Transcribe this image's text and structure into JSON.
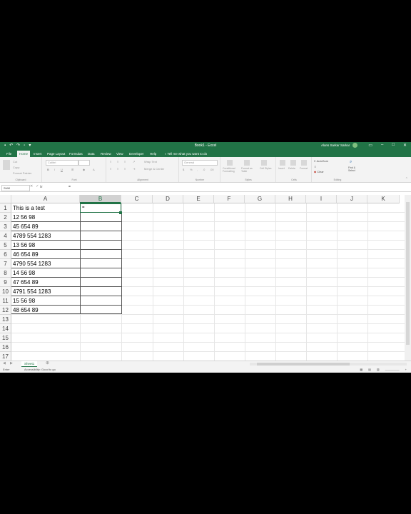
{
  "window": {
    "title": "Book1 - Excel",
    "user": "Alans Sarkar Sarkar"
  },
  "tabs": [
    {
      "label": "File"
    },
    {
      "label": "Home"
    },
    {
      "label": "Insert"
    },
    {
      "label": "Page Layout"
    },
    {
      "label": "Formulas"
    },
    {
      "label": "Data"
    },
    {
      "label": "Review"
    },
    {
      "label": "View"
    },
    {
      "label": "Developer"
    },
    {
      "label": "Help"
    }
  ],
  "tell_me": "Tell me what you want to do",
  "ribbon": {
    "clipboard": {
      "cut": "Cut",
      "copy": "Copy",
      "format_painter": "Format Painter",
      "label": "Clipboard"
    },
    "font": {
      "name": "Calibri",
      "label": "Font"
    },
    "alignment": {
      "wrap": "Wrap Text",
      "merge": "Merge & Center",
      "label": "Alignment"
    },
    "number": {
      "format": "General",
      "label": "Number"
    },
    "styles": {
      "conditional": "Conditional Formatting",
      "table": "Format as Table",
      "cell": "Cell Styles",
      "label": "Styles"
    },
    "cells": {
      "insert": "Insert",
      "delete": "Delete",
      "format": "Format",
      "label": "Cells"
    },
    "editing": {
      "autosum": "AutoSum",
      "clear": "Clear",
      "find": "Find & Select",
      "label": "Editing"
    }
  },
  "formula_bar": {
    "name_box": "SUM",
    "fx": "fx",
    "content": "="
  },
  "columns": [
    "A",
    "B",
    "C",
    "D",
    "E",
    "F",
    "G",
    "H",
    "I",
    "J",
    "K"
  ],
  "selected_column": "B",
  "rows": [
    "1",
    "2",
    "3",
    "4",
    "5",
    "6",
    "7",
    "8",
    "9",
    "10",
    "11",
    "12",
    "13",
    "14",
    "15",
    "16",
    "17"
  ],
  "cells_A": [
    "This is a test",
    "12 56 98",
    "45 654 89",
    "4789 554 1283",
    "13 56 98",
    "46 654 89",
    "4790 554 1283",
    "14 56 98",
    "47 654 89",
    "4791 554 1283",
    "15 56 98",
    "48 654 89"
  ],
  "active_cell_content": "=",
  "sheet_tab": "Sheet1",
  "status": {
    "mode": "Enter",
    "accessibility": "Accessibility: Good to go"
  },
  "colors": {
    "accent": "#217346"
  }
}
